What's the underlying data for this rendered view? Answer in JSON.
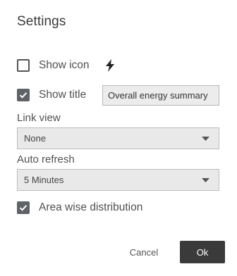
{
  "dialog": {
    "title": "Settings"
  },
  "show_icon": {
    "label": "Show icon",
    "checked": false,
    "icon": "lightning-bolt-icon"
  },
  "show_title": {
    "label": "Show title",
    "checked": true,
    "value": "Overall energy summary"
  },
  "link_view": {
    "label": "Link view",
    "selected": "None"
  },
  "auto_refresh": {
    "label": "Auto refresh",
    "selected": "5 Minutes"
  },
  "area_wise": {
    "label": "Area wise distribution",
    "checked": true
  },
  "buttons": {
    "cancel": "Cancel",
    "ok": "Ok"
  },
  "colors": {
    "primary_button": "#3a3a3a",
    "checkbox_checked": "#5f6368",
    "field_background": "#e9e9e9"
  }
}
